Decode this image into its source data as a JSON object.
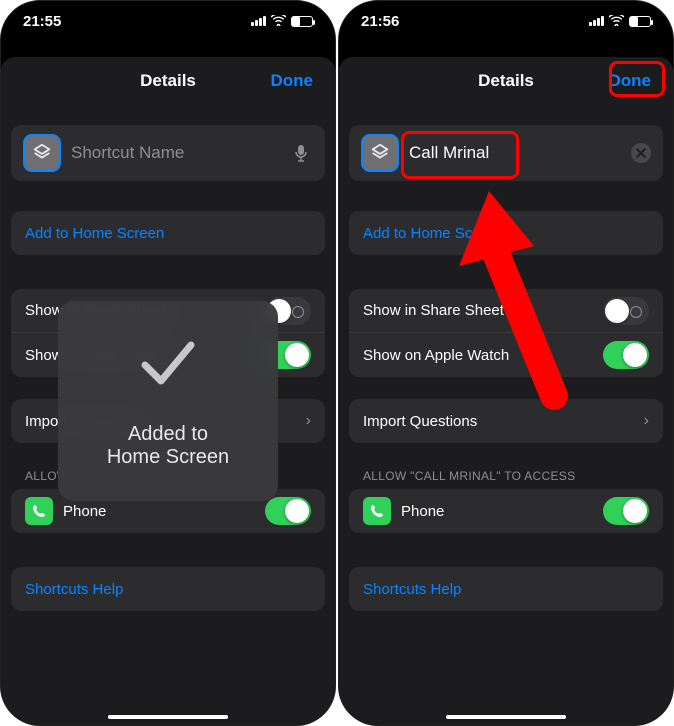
{
  "left": {
    "status_time": "21:55",
    "header_title": "Details",
    "done_label": "Done",
    "name_value": "",
    "name_placeholder": "Shortcut Name",
    "add_home_label": "Add to Home Screen",
    "show_share_label": "Show in Share Sheet",
    "show_watch_label": "Show on Apple Watch",
    "show_share_on": false,
    "show_watch_on": true,
    "import_label": "Import Questions",
    "allow_section": "ALLOW",
    "phone_label": "Phone",
    "phone_on": true,
    "help_label": "Shortcuts Help",
    "toast_line1": "Added to",
    "toast_line2": "Home Screen"
  },
  "right": {
    "status_time": "21:56",
    "header_title": "Details",
    "done_label": "Done",
    "name_value": "Call Mrinal",
    "name_placeholder": "Shortcut Name",
    "add_home_label": "Add to Home Screen",
    "show_share_label": "Show in Share Sheet",
    "show_watch_label": "Show on Apple Watch",
    "show_share_on": false,
    "show_watch_on": true,
    "import_label": "Import Questions",
    "allow_section": "ALLOW \"CALL MRINAL\" TO ACCESS",
    "phone_label": "Phone",
    "phone_on": true,
    "help_label": "Shortcuts Help"
  }
}
